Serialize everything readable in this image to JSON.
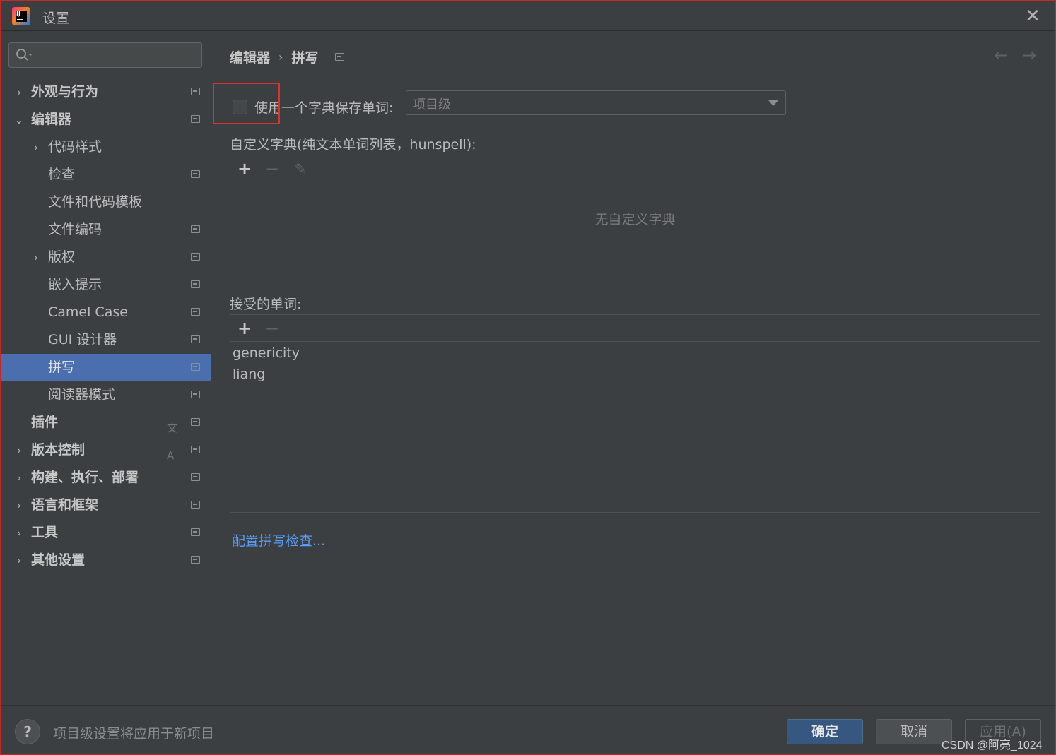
{
  "window": {
    "title": "设置",
    "close_glyph": "✕"
  },
  "sidebar": {
    "search": {
      "value": "",
      "placeholder": ""
    },
    "items": [
      {
        "label": "外观与行为",
        "bold": true,
        "level": 0,
        "chevron": "›",
        "project_icon": true
      },
      {
        "label": "编辑器",
        "bold": true,
        "level": 0,
        "chevron": "⌄",
        "project_icon": true
      },
      {
        "label": "代码样式",
        "bold": false,
        "level": 1,
        "chevron": "›",
        "project_icon": false
      },
      {
        "label": "检查",
        "bold": false,
        "level": 1,
        "chevron": "",
        "project_icon": true
      },
      {
        "label": "文件和代码模板",
        "bold": false,
        "level": 1,
        "chevron": "",
        "project_icon": false
      },
      {
        "label": "文件编码",
        "bold": false,
        "level": 1,
        "chevron": "",
        "project_icon": true
      },
      {
        "label": "版权",
        "bold": false,
        "level": 1,
        "chevron": "›",
        "project_icon": true
      },
      {
        "label": "嵌入提示",
        "bold": false,
        "level": 1,
        "chevron": "",
        "project_icon": true
      },
      {
        "label": "Camel Case",
        "bold": false,
        "level": 1,
        "chevron": "",
        "project_icon": true
      },
      {
        "label": "GUI 设计器",
        "bold": false,
        "level": 1,
        "chevron": "",
        "project_icon": true
      },
      {
        "label": "拼写",
        "bold": false,
        "level": 1,
        "chevron": "",
        "project_icon": true,
        "selected": true
      },
      {
        "label": "阅读器模式",
        "bold": false,
        "level": 1,
        "chevron": "",
        "project_icon": true
      },
      {
        "label": "插件",
        "bold": true,
        "level": 0,
        "chevron": "",
        "project_icon": true,
        "translate_icon": "文A"
      },
      {
        "label": "版本控制",
        "bold": true,
        "level": 0,
        "chevron": "›",
        "project_icon": true
      },
      {
        "label": "构建、执行、部署",
        "bold": true,
        "level": 0,
        "chevron": "›",
        "project_icon": true
      },
      {
        "label": "语言和框架",
        "bold": true,
        "level": 0,
        "chevron": "›",
        "project_icon": true
      },
      {
        "label": "工具",
        "bold": true,
        "level": 0,
        "chevron": "›",
        "project_icon": true
      },
      {
        "label": "其他设置",
        "bold": true,
        "level": 0,
        "chevron": "›",
        "project_icon": true
      }
    ]
  },
  "main": {
    "breadcrumb": {
      "parent": "编辑器",
      "separator": "›",
      "current": "拼写"
    },
    "nav": {
      "back": "←",
      "forward": "→"
    },
    "use_dictionary": {
      "label": "使用一个字典保存单词:",
      "checked": false,
      "dropdown_value": "项目级"
    },
    "custom_dictionaries": {
      "label": "自定义字典(纯文本单词列表，hunspell):",
      "toolbar": {
        "add": "+",
        "remove": "−",
        "edit": "✎"
      },
      "empty_text": "无自定义字典"
    },
    "accepted_words": {
      "label": "接受的单词:",
      "toolbar": {
        "add": "+",
        "remove": "−"
      },
      "words": [
        "genericity",
        "liang"
      ]
    },
    "configure_link": "配置拼写检查..."
  },
  "footer": {
    "help": "?",
    "hint": "项目级设置将应用于新项目",
    "ok": "确定",
    "cancel": "取消",
    "apply": "应用(A)",
    "watermark": "CSDN @阿亮_1024"
  },
  "colors": {
    "background": "#3c3f41",
    "selection": "#4b6eaf",
    "link": "#589df6",
    "primary_button": "#365880",
    "highlight_box": "#e0302a"
  }
}
